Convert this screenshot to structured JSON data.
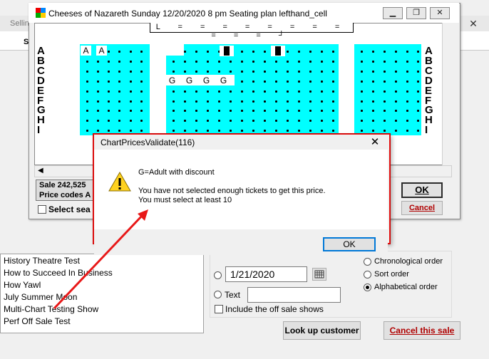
{
  "background_window": {
    "title": "Sellin",
    "close_icon": "close-icon",
    "header_fragment": "S"
  },
  "show_list": {
    "items": [
      "History Theatre Test",
      "How to Succeed In Business",
      "How Yawl",
      "July Summer Moon",
      "Multi-Chart Testing Show",
      "Perf Off Sale Test"
    ]
  },
  "filters": {
    "date_radio_value": "1/21/2020",
    "text_radio_label": "Text",
    "text_input_value": "",
    "include_off_sale_label": "Include the off sale shows",
    "order_options": [
      "Chronological order",
      "Sort order",
      "Alphabetical order"
    ],
    "selected_order": "Alphabetical order"
  },
  "buttons": {
    "look_up_customer": "Look up customer",
    "cancel_sale": "Cancel this sale"
  },
  "seating_window": {
    "title": "Cheeses of Nazareth   Sunday 12/20/2020 8 pm     Seating plan lefthand_cell",
    "row_labels": [
      "A",
      "B",
      "C",
      "D",
      "E",
      "F",
      "G",
      "H",
      "I"
    ],
    "stage_text": "L  = = = = = = = = = = =  ┘",
    "seat_labels_row_a": [
      "A",
      "A"
    ],
    "seat_labels_row_d": [
      "G",
      "G",
      "G",
      "G"
    ],
    "sale_text": "Sale 242,525",
    "price_codes_text": "Price codes A",
    "select_seats_label": "Select sea",
    "ok_label": "OK",
    "cancel_label": "Cancel",
    "colors": {
      "seat_block": "#00ffff"
    }
  },
  "dialog": {
    "title": "ChartPricesValidate(116)",
    "icon": "warning-icon",
    "line1": "G=Adult with discount",
    "line2": "You have not selected enough tickets to get this price.",
    "line3": "You must select at least 10",
    "ok_label": "OK"
  },
  "annotation": {
    "arrow_color": "#e81818"
  }
}
